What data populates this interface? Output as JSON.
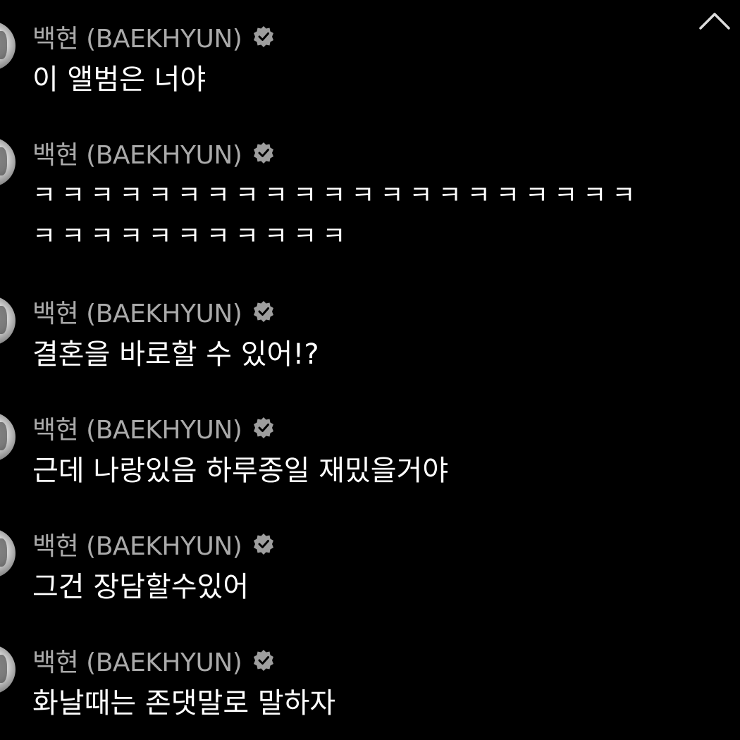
{
  "header": {
    "collapse_icon": "chevron-up-icon"
  },
  "colors": {
    "background": "#000000",
    "author": "#aaaaaa",
    "text": "#ffffff",
    "verified": "#9e9e9e"
  },
  "messages": [
    {
      "author": "백현 (BAEKHYUN)",
      "verified_icon": "verified-badge-icon",
      "text": "이 앨범은 너야"
    },
    {
      "author": "백현 (BAEKHYUN)",
      "verified_icon": "verified-badge-icon",
      "text": "ㅋㅋㅋㅋㅋㅋㅋㅋㅋㅋㅋㅋㅋㅋㅋㅋㅋㅋㅋㅋㅋ\nㅋㅋㅋㅋㅋㅋㅋㅋㅋㅋㅋ"
    },
    {
      "author": "백현 (BAEKHYUN)",
      "verified_icon": "verified-badge-icon",
      "text": "결혼을 바로할 수 있어!?"
    },
    {
      "author": "백현 (BAEKHYUN)",
      "verified_icon": "verified-badge-icon",
      "text": "근데 나랑있음 하루종일 재밌을거야"
    },
    {
      "author": "백현 (BAEKHYUN)",
      "verified_icon": "verified-badge-icon",
      "text": "그건 장담할수있어"
    },
    {
      "author": "백현 (BAEKHYUN)",
      "verified_icon": "verified-badge-icon",
      "text": "화날때는 존댓말로 말하자"
    }
  ]
}
